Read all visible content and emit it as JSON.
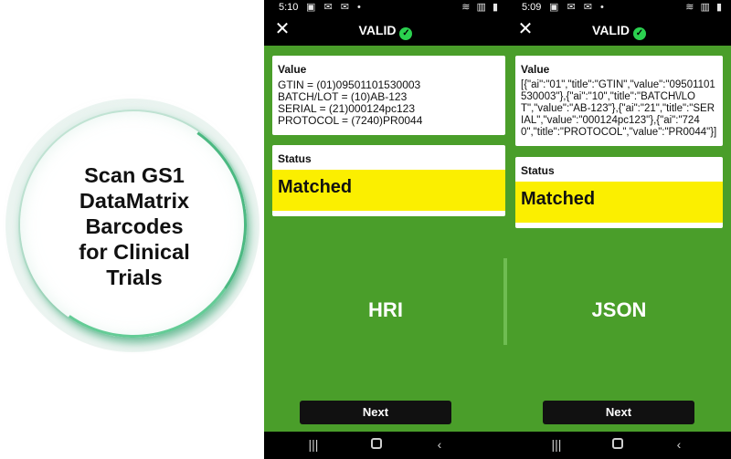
{
  "promo": {
    "title_lines": [
      "Scan GS1",
      "DataMatrix",
      "Barcodes",
      "for Clinical",
      "Trials"
    ]
  },
  "phones": [
    {
      "statusbar": {
        "time": "5:10",
        "icons": "▣ ✉ ✉ •",
        "right": "≋ ▥ ▮"
      },
      "title": "VALID",
      "value_label": "Value",
      "value_lines": [
        "GTIN = (01)09501101530003",
        "BATCH/LOT = (10)AB-123",
        "SERIAL = (21)000124pc123",
        "PROTOCOL = (7240)PR0044"
      ],
      "status_label": "Status",
      "status_value": "Matched",
      "mode": "HRI",
      "next_label": "Next"
    },
    {
      "statusbar": {
        "time": "5:09",
        "icons": "▣ ✉ ✉ •",
        "right": "≋ ▥ ▮"
      },
      "title": "VALID",
      "value_label": "Value",
      "value_text": "[{\"ai\":\"01\",\"title\":\"GTIN\",\"value\":\"09501101530003\"},{\"ai\":\"10\",\"title\":\"BATCH\\/LOT\",\"value\":\"AB-123\"},{\"ai\":\"21\",\"title\":\"SERIAL\",\"value\":\"000124pc123\"},{\"ai\":\"7240\",\"title\":\"PROTOCOL\",\"value\":\"PR0044\"}]",
      "status_label": "Status",
      "status_value": "Matched",
      "mode": "JSON",
      "next_label": "Next"
    }
  ],
  "colors": {
    "screen_green": "#4a9e2a",
    "status_yellow": "#fbef00",
    "valid_check": "#2bd14f"
  },
  "icons": {
    "close": "close-icon",
    "valid": "check-circle-icon",
    "nav_recent": "recent-apps-icon",
    "nav_home": "home-icon",
    "nav_back": "back-icon"
  }
}
